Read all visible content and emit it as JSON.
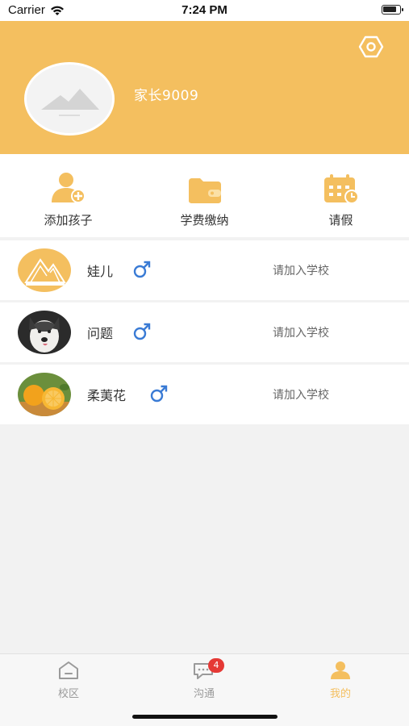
{
  "status_bar": {
    "carrier": "Carrier",
    "time": "7:24 PM"
  },
  "profile": {
    "username": "家长9009"
  },
  "actions": [
    {
      "label": "添加孩子",
      "icon": "add-user-icon"
    },
    {
      "label": "学费缴纳",
      "icon": "wallet-icon"
    },
    {
      "label": "请假",
      "icon": "calendar-icon"
    }
  ],
  "children": [
    {
      "name": "娃儿",
      "gender": "male",
      "gender_symbol": "♂",
      "action": "请加入学校"
    },
    {
      "name": "问题",
      "gender": "male",
      "gender_symbol": "♂",
      "action": "请加入学校"
    },
    {
      "name": "柔荑花",
      "gender": "male",
      "gender_symbol": "♂",
      "action": "请加入学校"
    }
  ],
  "tabbar": {
    "tabs": [
      {
        "label": "校区",
        "icon": "home-icon",
        "active": false
      },
      {
        "label": "沟通",
        "icon": "chat-icon",
        "active": false,
        "badge": "4"
      },
      {
        "label": "我的",
        "icon": "person-icon",
        "active": true
      }
    ]
  },
  "colors": {
    "accent": "#f4bf5f",
    "gender_male": "#3a7bd5",
    "badge": "#e53935",
    "inactive_tab": "#9a9a9a"
  }
}
